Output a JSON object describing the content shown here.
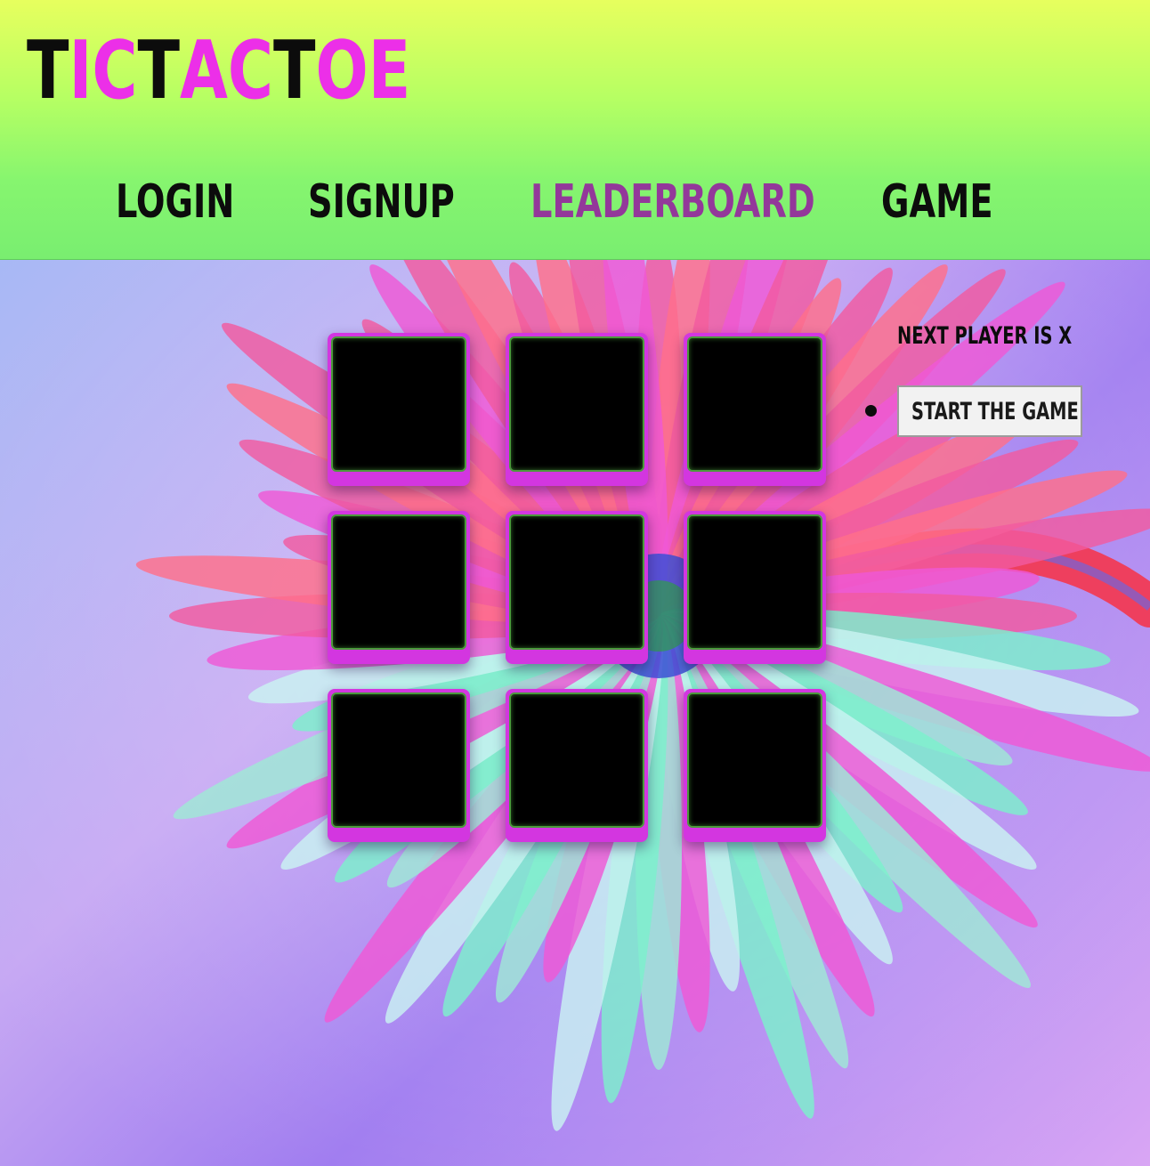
{
  "logo": {
    "parts": [
      "T",
      "IC",
      "T",
      "AC",
      "T",
      "OE"
    ],
    "colors": {
      "dark": "#0c0c0c",
      "accent": "#ec2fe8"
    }
  },
  "nav": {
    "items": [
      {
        "label": "LOGIN",
        "active": false
      },
      {
        "label": "SIGNUP",
        "active": false
      },
      {
        "label": "LEADERBOARD",
        "active": true
      },
      {
        "label": "GAME",
        "active": false
      }
    ],
    "active_color": "#93389a"
  },
  "game": {
    "status": "NEXT PLAYER IS X",
    "start_button": "START THE GAME",
    "board": [
      "",
      "",
      "",
      "",
      "",
      "",
      "",
      "",
      ""
    ],
    "cell_color": "#d336e0",
    "cell_face_color": "#000000"
  },
  "theme": {
    "header_top": "#e7ff5e",
    "header_bottom": "#79ee70"
  }
}
